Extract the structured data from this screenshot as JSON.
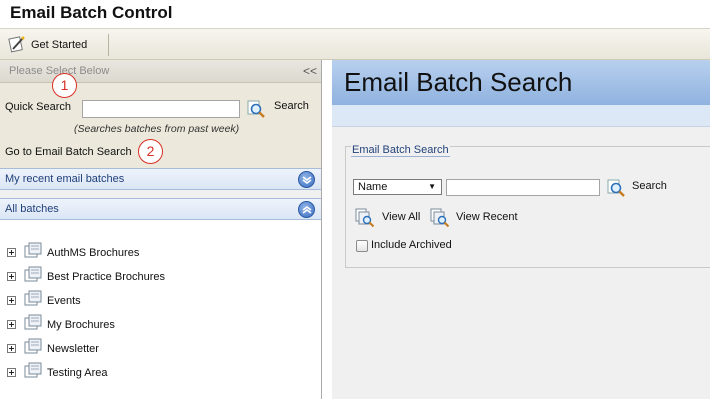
{
  "app": {
    "title": "Email Batch Control"
  },
  "toolbar": {
    "get_started_label": "Get Started",
    "get_started_icon": "magic-wand-icon"
  },
  "left_panel": {
    "header": "Please Select Below",
    "collapse_glyph": "<<",
    "quick_search": {
      "label": "Quick Search",
      "value": "",
      "button_label": "Search",
      "note": "(Searches batches from past week)"
    },
    "goto_link": "Go to Email Batch Search",
    "callouts": [
      "1",
      "2"
    ],
    "recent_section": {
      "label": "My recent email batches",
      "state": "collapsed"
    },
    "all_section": {
      "label": "All batches",
      "state": "expanded"
    },
    "tree_items": [
      {
        "label": "AuthMS Brochures"
      },
      {
        "label": "Best Practice Brochures"
      },
      {
        "label": "Events"
      },
      {
        "label": "My Brochures"
      },
      {
        "label": "Newsletter"
      },
      {
        "label": "Testing Area"
      }
    ]
  },
  "right_panel": {
    "title": "Email Batch Search",
    "search_box": {
      "legend": "Email Batch Search",
      "field_select": "Name",
      "query_value": "",
      "search_label": "Search",
      "view_all_label": "View All",
      "view_recent_label": "View Recent",
      "include_archived_label": "Include Archived",
      "include_archived_checked": false
    }
  },
  "colors": {
    "header_gradient_top": "#b8d0ee",
    "header_gradient_bottom": "#8fb2df",
    "accordion_text": "#1f3f7a",
    "callout": "#d93025"
  }
}
